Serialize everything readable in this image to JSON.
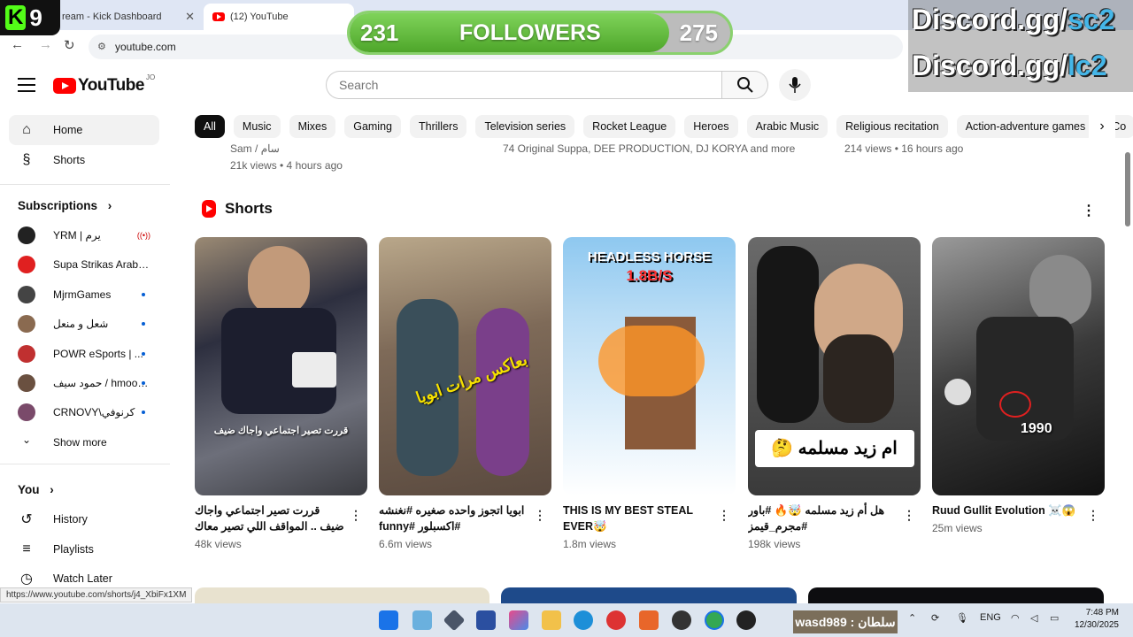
{
  "browser": {
    "tabs": [
      {
        "title": "ream - Kick Dashboard",
        "active": false
      },
      {
        "title": "(12) YouTube",
        "active": true
      }
    ],
    "url": "youtube.com",
    "status_url": "https://www.youtube.com/shorts/j4_XbiFx1XM"
  },
  "overlay": {
    "badge": "9",
    "badge_letter": "K",
    "followers_current": "231",
    "followers_label": "FOLLOWERS",
    "followers_goal": "275",
    "followers_progress": 0.84,
    "discord_lines": [
      {
        "prefix": "Discord.gg/",
        "accent": "sc2"
      },
      {
        "prefix": "Discord.gg/",
        "accent": "lc2"
      }
    ]
  },
  "header": {
    "logo_text": "YouTube",
    "country": "JO",
    "search_placeholder": "Search"
  },
  "chips": [
    "All",
    "Music",
    "Mixes",
    "Gaming",
    "Thrillers",
    "Television series",
    "Rocket League",
    "Heroes",
    "Arabic Music",
    "Religious recitation",
    "Action-adventure games",
    "Co"
  ],
  "sidebar": {
    "home": "Home",
    "shorts": "Shorts",
    "subscriptions_label": "Subscriptions",
    "subscriptions": [
      {
        "name": "YRM | يرم",
        "color": "#222222",
        "indicator": "live"
      },
      {
        "name": "Supa Strikas Arabic...",
        "color": "#e02020",
        "indicator": "none"
      },
      {
        "name": "MjrmGames",
        "color": "#444444",
        "indicator": "dot"
      },
      {
        "name": "شعل و منعل",
        "color": "#8a6a50",
        "indicator": "dot"
      },
      {
        "name": "POWR eSports | ...",
        "color": "#c03030",
        "indicator": "dot"
      },
      {
        "name": "حمود سيف / hmood...",
        "color": "#6a5040",
        "indicator": "dot"
      },
      {
        "name": "CRNOVY\\كرنوفي",
        "color": "#7a4a6a",
        "indicator": "dot"
      }
    ],
    "show_more": "Show more",
    "you_label": "You",
    "history": "History",
    "playlists": "Playlists",
    "watch_later": "Watch Later"
  },
  "prev_row": [
    {
      "line1": "Sam / سام",
      "line2": "21k views • 4 hours ago"
    },
    {
      "line1": "74 Original Suppa, DEE PRODUCTION, DJ KORYA and more",
      "line2": ""
    },
    {
      "line1": "214 views • 16 hours ago",
      "line2": ""
    }
  ],
  "shorts": {
    "section_title": "Shorts",
    "items": [
      {
        "title": "قررت تصير اجتماعي واجاك ضيف .. المواقف اللي تصير معاك 😂💔",
        "views": "48k views",
        "overlay": "قررت تصير اجتماعي واجاك ضيف"
      },
      {
        "title": "ابويا اتجوز واحده صغيره #نغنشه #اكسبلور #funny",
        "views": "6.6m views",
        "overlay": "بعاكس مرات ابويا"
      },
      {
        "title": "THIS IS MY BEST STEAL EVER🤯",
        "views": "1.8m views",
        "overlay": "HEADLESS HORSE"
      },
      {
        "title": "هل أم زيد مسلمه 🤯🔥 #باور #مجرم_قيمز",
        "views": "198k views",
        "overlay": "ام زيد مسلمه 🤔"
      },
      {
        "title": "Ruud Gullit Evolution ☠️😱",
        "views": "25m views",
        "overlay": "1990"
      }
    ],
    "thumb_extra": "1.8B/S"
  },
  "taskbar": {
    "streamer_tag": "wasd989 : سلطان",
    "lang": "ENG",
    "time": "7:48 PM",
    "date": "12/30/2025"
  }
}
